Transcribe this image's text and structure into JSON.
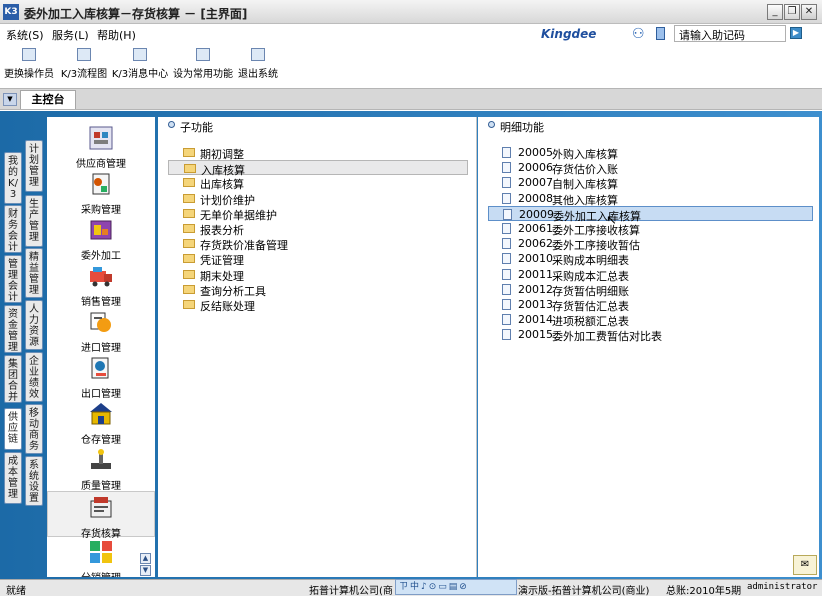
{
  "window": {
    "app_icon": "K3",
    "title": "委外加工入库核算－存货核算 － [主界面]",
    "minimize": "_",
    "restore": "❐",
    "close": "✕"
  },
  "menu": {
    "system": "系统(S)",
    "service": "服务(L)",
    "help": "帮助(H)",
    "logo": "Kingdee",
    "help_placeholder": "请输入助记码",
    "go": "▶"
  },
  "toolbar": {
    "items": [
      {
        "label": "更换操作员",
        "icon": "switch-user-icon"
      },
      {
        "label": "K/3流程图",
        "icon": "flowchart-icon"
      },
      {
        "label": "K/3消息中心",
        "icon": "message-center-icon"
      },
      {
        "label": "设为常用功能",
        "icon": "favorite-icon"
      },
      {
        "label": "退出系统",
        "icon": "exit-icon"
      }
    ]
  },
  "tabstrip": {
    "active_tab": "主控台",
    "drop_glyph": "▼"
  },
  "left_tabs": {
    "col1": [
      "我的K/3",
      "财务会计",
      "管理会计",
      "资金管理",
      "集团合并",
      "供应链",
      "成本管理"
    ],
    "col2": [
      "计划管理",
      "生产管理",
      "精益管理",
      "人力资源",
      "企业绩效",
      "移动商务",
      "系统设置"
    ]
  },
  "modules": [
    {
      "label": "供应商管理",
      "icon": "supplier-management-icon"
    },
    {
      "label": "采购管理",
      "icon": "purchase-management-icon"
    },
    {
      "label": "委外加工",
      "icon": "outsourcing-icon"
    },
    {
      "label": "销售管理",
      "icon": "sales-management-icon"
    },
    {
      "label": "进口管理",
      "icon": "import-management-icon"
    },
    {
      "label": "出口管理",
      "icon": "export-management-icon"
    },
    {
      "label": "仓存管理",
      "icon": "warehouse-icon"
    },
    {
      "label": "质量管理",
      "icon": "quality-management-icon"
    },
    {
      "label": "存货核算",
      "icon": "inventory-accounting-icon"
    },
    {
      "label": "分销管理",
      "icon": "distribution-icon"
    }
  ],
  "subfunctions": {
    "header": "子功能",
    "items": [
      "期初调整",
      "入库核算",
      "出库核算",
      "计划价维护",
      "无单价单据维护",
      "报表分析",
      "存货跌价准备管理",
      "凭证管理",
      "期末处理",
      "查询分析工具",
      "反结账处理"
    ],
    "selected_index": 1
  },
  "details": {
    "header": "明细功能",
    "items": [
      {
        "code": "20005",
        "label": "外购入库核算"
      },
      {
        "code": "20006",
        "label": "存货估价入账"
      },
      {
        "code": "20007",
        "label": "自制入库核算"
      },
      {
        "code": "20008",
        "label": "其他入库核算"
      },
      {
        "code": "20009",
        "label": "委外加工入库核算"
      },
      {
        "code": "20061",
        "label": "委外工序接收核算"
      },
      {
        "code": "20062",
        "label": "委外工序接收暂估"
      },
      {
        "code": "20010",
        "label": "采购成本明细表"
      },
      {
        "code": "20011",
        "label": "采购成本汇总表"
      },
      {
        "code": "20012",
        "label": "存货暂估明细账"
      },
      {
        "code": "20013",
        "label": "存货暂估汇总表"
      },
      {
        "code": "20014",
        "label": "进项税额汇总表"
      },
      {
        "code": "20015",
        "label": "委外加工费暂估对比表"
      }
    ],
    "selected_index": 4
  },
  "statusbar": {
    "ready": "就绪",
    "company": "拓普计算机公司(商",
    "ime": "ㄗ中♪⊙▭▤⊘",
    "demo": "演示版-拓普计算机公司(商业)",
    "period": "总账:2010年5期",
    "user": "administrator"
  },
  "colors": {
    "frame_blue": "#2b7cbd",
    "selection": "#c7dcf3"
  }
}
